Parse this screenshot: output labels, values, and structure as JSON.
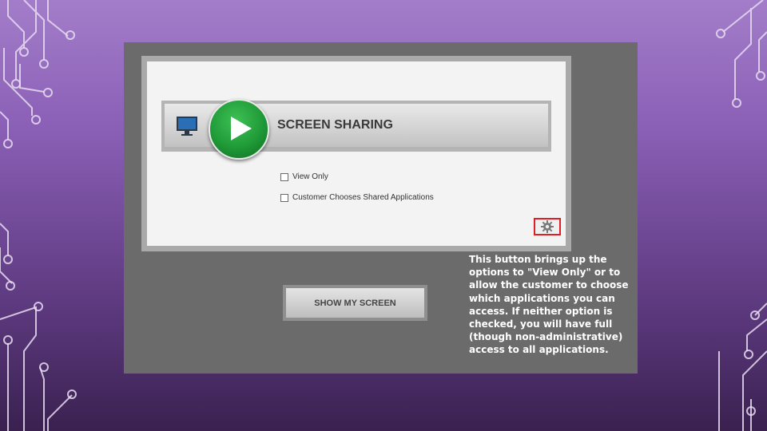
{
  "dialog": {
    "title": "SCREEN SHARING",
    "options": [
      {
        "label": "View Only",
        "checked": false
      },
      {
        "label": "Customer Chooses Shared Applications",
        "checked": false
      }
    ],
    "settings_icon": "gear-icon",
    "highlight_color": "#e01e25"
  },
  "show_screen_button": {
    "label": "SHOW MY SCREEN"
  },
  "annotation": {
    "text": "This button brings up the options to \"View Only\" or to allow the customer to choose which applications you can access. If neither option is checked, you will have full (though non-administrative) access to all applications."
  },
  "icons": {
    "monitor": "monitor-icon",
    "play": "play-icon"
  },
  "colors": {
    "play_green": "#1f9a37",
    "panel_gray": "#6b6b6b"
  }
}
